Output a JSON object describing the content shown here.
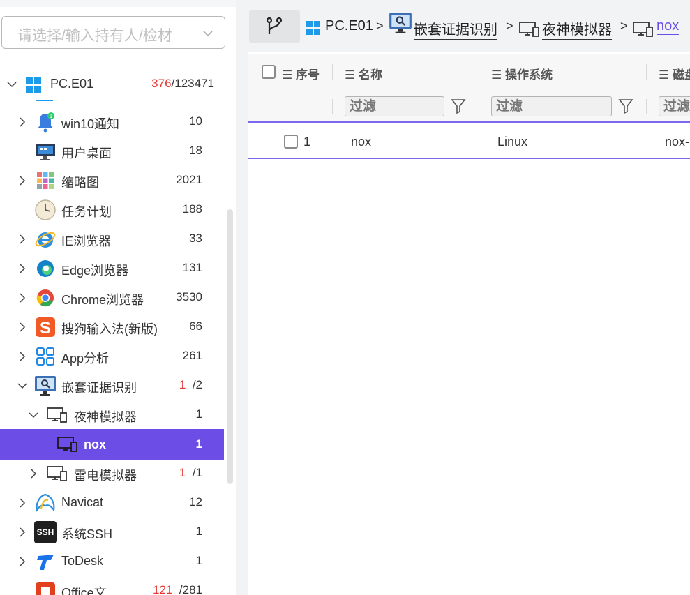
{
  "search": {
    "placeholder": "请选择/输入持有人/检材"
  },
  "tree": [
    {
      "label": "PC.E01",
      "count_red": "376",
      "count_rest": "/123471",
      "icon": "windows-icon"
    },
    {
      "label": "win10通知",
      "count": "10",
      "icon": "bell-icon"
    },
    {
      "label": "用户桌面",
      "count": "18",
      "icon": "desktop-icon"
    },
    {
      "label": "缩略图",
      "count": "2021",
      "icon": "thumbnail-icon"
    },
    {
      "label": "任务计划",
      "count": "188",
      "icon": "clock-icon"
    },
    {
      "label": "IE浏览器",
      "count": "33",
      "icon": "ie-icon"
    },
    {
      "label": "Edge浏览器",
      "count": "131",
      "icon": "edge-icon"
    },
    {
      "label": "Chrome浏览器",
      "count": "3530",
      "icon": "chrome-icon"
    },
    {
      "label": "搜狗输入法(新版)",
      "count": "66",
      "icon": "sogou-icon"
    },
    {
      "label": "App分析",
      "count": "261",
      "icon": "app-grid-icon"
    },
    {
      "label": "嵌套证据识别",
      "count_red": "1",
      "count_rest": "/2",
      "icon": "monitor-search-icon"
    },
    {
      "label": "夜神模拟器",
      "count": "1",
      "icon": "device-icon"
    },
    {
      "label": "nox",
      "count": "1",
      "icon": "device-icon"
    },
    {
      "label": "雷电模拟器",
      "count_red": "1",
      "count_rest": "/1",
      "icon": "device-icon"
    },
    {
      "label": "Navicat",
      "count": "12",
      "icon": "navicat-icon"
    },
    {
      "label": "系统SSH",
      "count": "1",
      "icon": "ssh-icon"
    },
    {
      "label": "ToDesk",
      "count": "1",
      "icon": "todesk-icon"
    },
    {
      "label": "Office文…",
      "count_red": "121",
      "count_rest": "/281",
      "icon": "office-icon"
    }
  ],
  "ssh_badge": "SSH",
  "breadcrumb": {
    "items": [
      "PC.E01",
      "嵌套证据识别",
      "夜神模拟器",
      "nox"
    ],
    "separator": ">"
  },
  "table": {
    "columns": [
      "序号",
      "名称",
      "操作系统",
      "磁盘"
    ],
    "filter_placeholder": "过滤",
    "rows": [
      {
        "index": "1",
        "name": "nox",
        "os": "Linux",
        "disk": "nox-"
      }
    ]
  },
  "colors": {
    "accent": "#6c4ee6",
    "red": "#e53935",
    "row_border": "#7b68ee"
  }
}
